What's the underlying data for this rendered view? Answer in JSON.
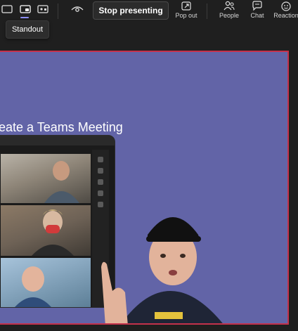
{
  "toolbar": {
    "view_buttons": [
      {
        "icon": "content-only-icon"
      },
      {
        "icon": "standout-icon",
        "active": true
      },
      {
        "icon": "side-by-side-icon"
      }
    ],
    "laser_icon": "eye-icon",
    "stop_presenting_label": "Stop presenting",
    "popout_label": "Pop out",
    "people_label": "People",
    "chat_label": "Chat",
    "reactions_label": "Reaction"
  },
  "tooltip": {
    "label": "Standout"
  },
  "slide": {
    "title": "eate a Teams Meeting"
  },
  "colors": {
    "stage_background": "#6264a7",
    "presenting_border": "#c4314b",
    "accent": "#8b8cf5",
    "chrome": "#1f1f1f"
  }
}
